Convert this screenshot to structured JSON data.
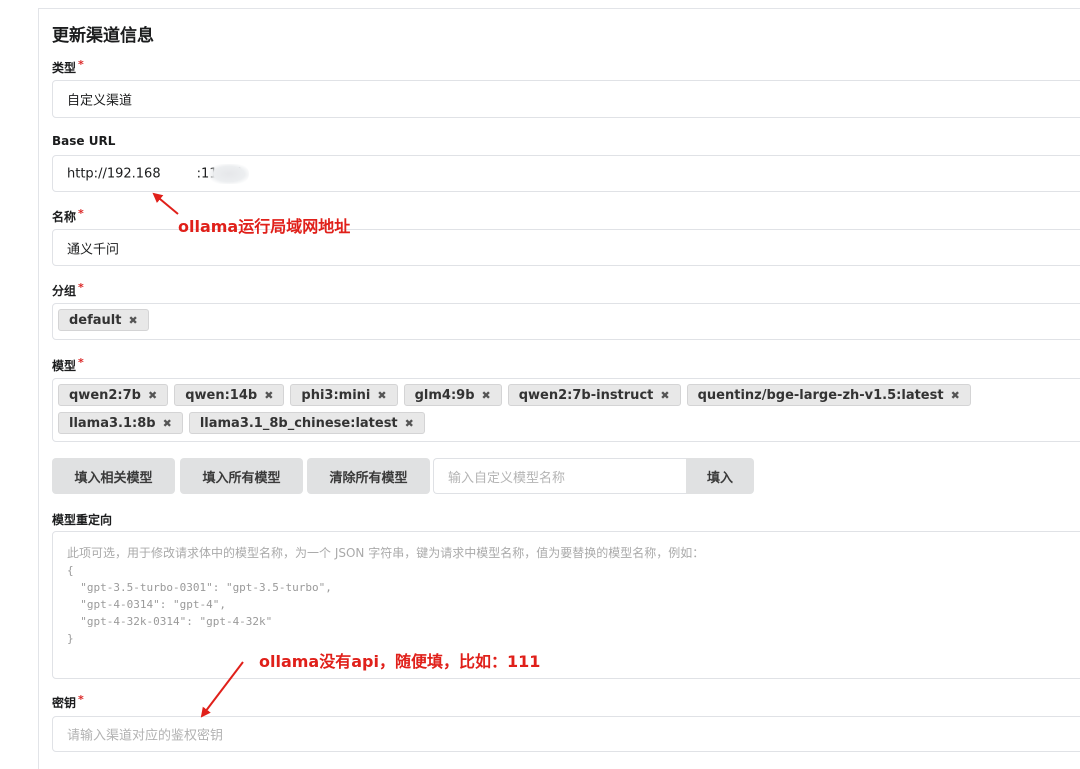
{
  "form": {
    "title": "更新渠道信息",
    "type": {
      "label": "类型",
      "required_mark": "*",
      "value": "自定义渠道"
    },
    "base_url": {
      "label": "Base URL",
      "value_prefix": "http://192.168",
      "value_suffix": ":11434"
    },
    "name": {
      "label": "名称",
      "required_mark": "*",
      "value": "通义千问"
    },
    "group": {
      "label": "分组",
      "required_mark": "*",
      "chips": [
        "default"
      ]
    },
    "models": {
      "label": "模型",
      "required_mark": "*",
      "chips": [
        "qwen2:7b",
        "qwen:14b",
        "phi3:mini",
        "glm4:9b",
        "qwen2:7b-instruct",
        "quentinz/bge-large-zh-v1.5:latest",
        "llama3.1:8b",
        "llama3.1_8b_chinese:latest"
      ]
    },
    "model_buttons": {
      "fill_related": "填入相关模型",
      "fill_all": "填入所有模型",
      "clear_all": "清除所有模型",
      "custom_placeholder": "输入自定义模型名称",
      "fill": "填入"
    },
    "model_redirect": {
      "label": "模型重定向",
      "hint": "此项可选，用于修改请求体中的模型名称，为一个 JSON 字符串，键为请求中模型名称，值为要替换的模型名称，例如：",
      "example": "{\n  \"gpt-3.5-turbo-0301\": \"gpt-3.5-turbo\",\n  \"gpt-4-0314\": \"gpt-4\",\n  \"gpt-4-32k-0314\": \"gpt-4-32k\"\n}"
    },
    "secret": {
      "label": "密钥",
      "required_mark": "*",
      "placeholder": "请输入渠道对应的鉴权密钥"
    }
  },
  "annotations": {
    "lan_address": "ollama运行局域网地址",
    "no_api": "ollama没有api，随便填，比如：111"
  },
  "colors": {
    "annotation_red": "#e0201a",
    "required_red": "#db2828",
    "button_gray": "#e0e1e2",
    "chip_gray": "#e8e8e8"
  }
}
